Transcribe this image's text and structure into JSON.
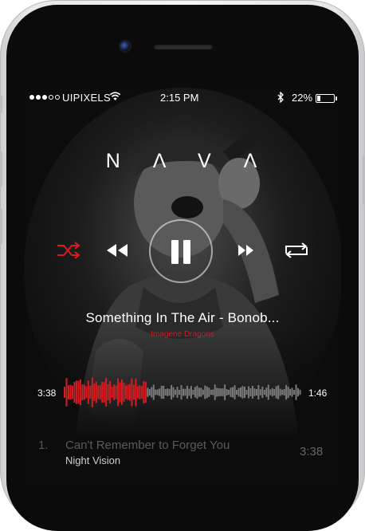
{
  "status": {
    "carrier": "UIPIXELS",
    "time": "2:15 PM",
    "battery": "22%",
    "battery_level": 0.22,
    "signal_bars": 3,
    "signal_total": 5
  },
  "app": {
    "logo": "N Λ V Λ"
  },
  "controls": {
    "shuffle_icon": "shuffle-icon",
    "shuffle_active_color": "#d71d22",
    "rewind_icon": "rewind-icon",
    "pause_icon": "pause-icon",
    "forward_icon": "fast-forward-icon",
    "repeat_icon": "repeat-icon"
  },
  "now_playing": {
    "title": "Something In The Air - Bonob...",
    "artist": "Imagene Dragons",
    "elapsed": "3:38",
    "remaining": "1:46",
    "progress": 0.35
  },
  "playlist": [
    {
      "number": "1.",
      "title": "Can't Remember to Forget You",
      "artist": "Night Vision",
      "duration": "3:38"
    }
  ],
  "colors": {
    "accent": "#d71d22",
    "background": "#0c0c0c",
    "waveform_inactive": "#7a7a7a"
  }
}
